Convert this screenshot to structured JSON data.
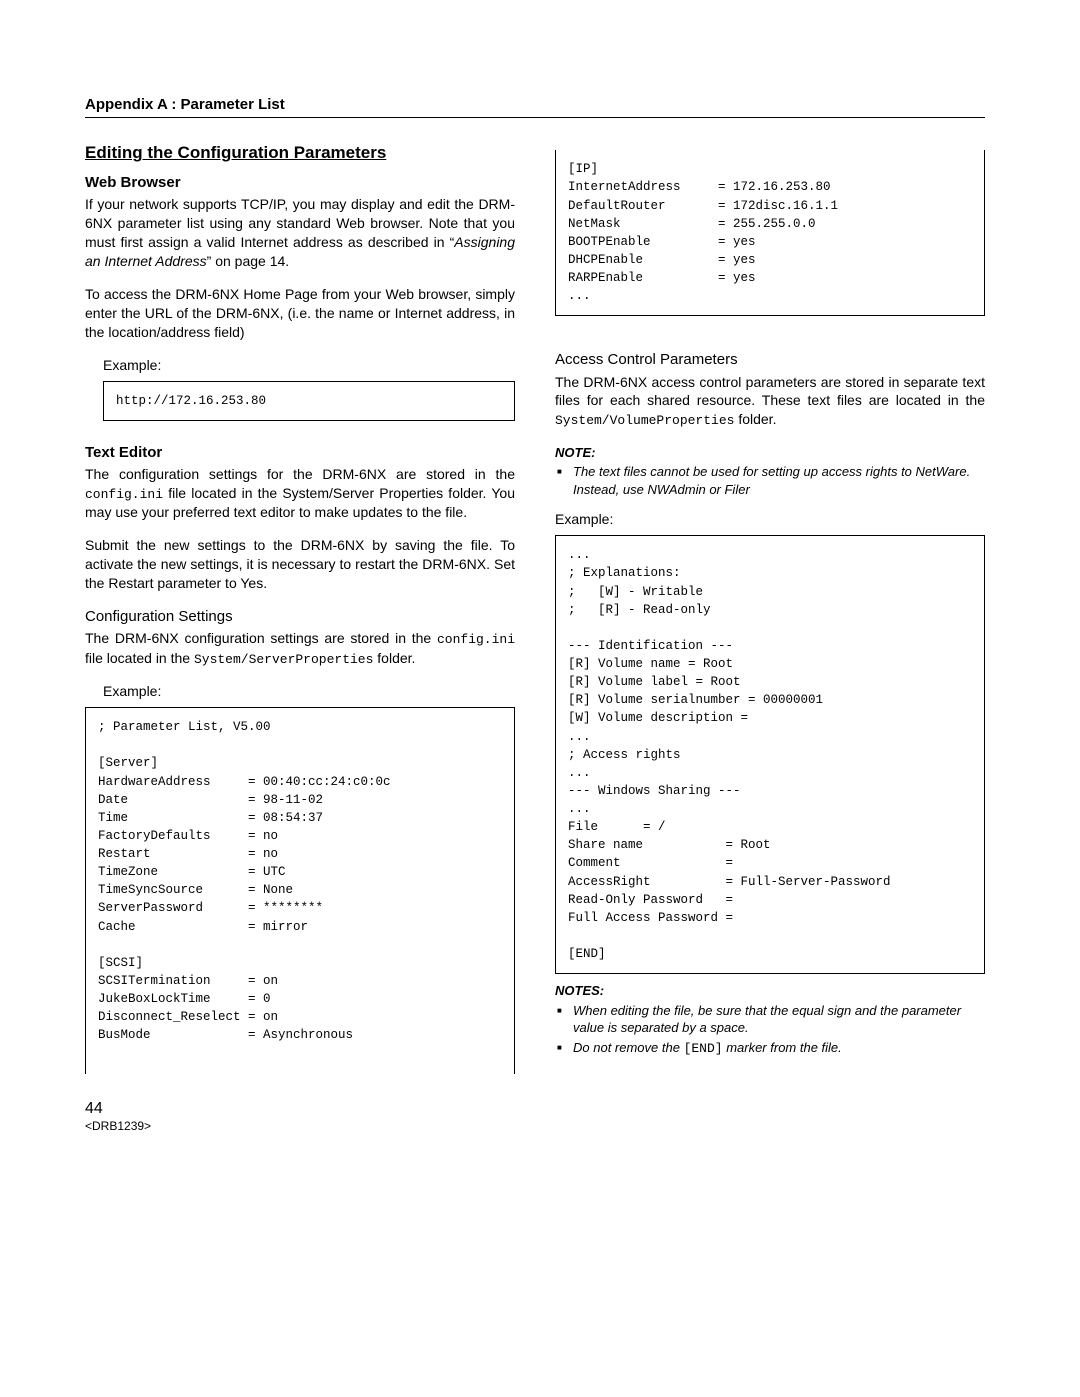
{
  "appendix": "Appendix A :  Parameter List",
  "sectionTitle": "Editing the Configuration Parameters",
  "webBrowser": {
    "heading": "Web Browser",
    "para1_prefix": "If your network supports TCP/IP, you may display and edit the DRM-6NX parameter list using any standard Web browser. Note that you must first assign a valid Internet address as described in “",
    "para1_italic": "Assigning an Internet Address",
    "para1_suffix": "”  on page 14.",
    "para2": "To access the DRM-6NX Home Page from your Web browser, simply enter the URL of the DRM-6NX, (i.e. the name or Internet address, in the location/address field)",
    "exampleLabel": "Example:",
    "exampleText": "http://172.16.253.80"
  },
  "textEditor": {
    "heading": "Text Editor",
    "para1_prefix": "The configuration settings for the DRM-6NX are stored in the ",
    "para1_mono": "config.ini",
    "para1_suffix": " file located in the System/Server Properties folder. You may use your preferred text editor to make updates to the file.",
    "para2": "Submit the new settings to the DRM-6NX by saving the file. To activate the new settings, it is necessary to restart the DRM-6NX. Set the Restart parameter to Yes."
  },
  "configSettings": {
    "heading": "Configuration Settings",
    "para_prefix": "The DRM-6NX configuration settings are stored in the ",
    "para_mono1": "config.ini",
    "para_mid": " file located in the ",
    "para_mono2": "System/ServerProperties",
    "para_suffix": " folder.",
    "exampleLabel": "Example:",
    "exampleLeft": "; Parameter List, V5.00\n\n[Server]\nHardwareAddress     = 00:40:cc:24:c0:0c\nDate                = 98-11-02\nTime                = 08:54:37\nFactoryDefaults     = no\nRestart             = no\nTimeZone            = UTC\nTimeSyncSource      = None\nServerPassword      = ********\nCache               = mirror\n\n[SCSI]\nSCSITermination     = on\nJukeBoxLockTime     = 0\nDisconnect_Reselect = on\nBusMode             = Asynchronous",
    "exampleRight": "[IP]\nInternetAddress     = 172.16.253.80\nDefaultRouter       = 172disc.16.1.1\nNetMask             = 255.255.0.0\nBOOTPEnable         = yes\nDHCPEnable          = yes\nRARPEnable          = yes\n..."
  },
  "accessControl": {
    "heading": "Access Control Parameters",
    "para_prefix": "The DRM-6NX access control parameters are stored in separate text files for each shared resource. These text files are located in the ",
    "para_mono": "System/VolumeProperties",
    "para_suffix": " folder.",
    "noteLabel": "NOTE:",
    "noteItem": "The text files cannot be used for setting up access rights to NetWare. Instead, use NWAdmin or Filer",
    "exampleLabel": "Example:",
    "exampleText": "...\n; Explanations:\n;   [W] - Writable\n;   [R] - Read-only\n\n--- Identification ---\n[R] Volume name = Root\n[R] Volume label = Root\n[R] Volume serialnumber = 00000001\n[W] Volume description =\n...\n; Access rights\n...\n--- Windows Sharing ---\n...\nFile      = /\nShare name           = Root\nComment              =\nAccessRight          = Full-Server-Password\nRead-Only Password   =\nFull Access Password =\n\n[END]",
    "notesLabel": "NOTES:",
    "notes": [
      "When editing the file, be sure that the equal sign and the parameter value is separated by a space.",
      "Do not remove the [END] marker from the file."
    ],
    "notes2_prefix": "Do not remove the ",
    "notes2_mono": "[END]",
    "notes2_suffix": " marker from the file."
  },
  "footer": {
    "pageNumber": "44",
    "docId": "<DRB1239>"
  }
}
